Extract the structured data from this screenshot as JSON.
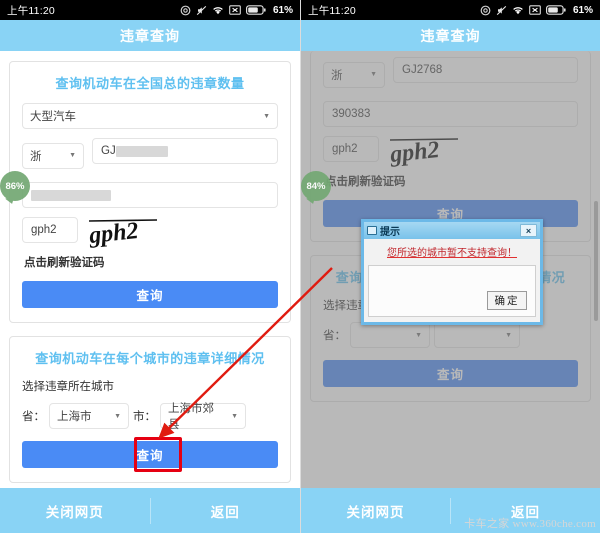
{
  "status_bar": {
    "time": "上午11:20",
    "battery_percent": "61%",
    "icons": [
      "ring-icon",
      "mute-icon",
      "wifi-icon",
      "no-sim-icon",
      "battery-icon"
    ]
  },
  "title_bar": {
    "title": "违章查询"
  },
  "bottom_bar": {
    "close_label": "关闭网页",
    "back_label": "返回"
  },
  "left_panel": {
    "badge": "86%",
    "card1": {
      "title": "查询机动车在全国总的违章数量",
      "vehicle_type": "大型汽车",
      "province": "浙",
      "plate_prefix": "GJ",
      "plate_rest": "",
      "vin": "",
      "captcha_value": "gph2",
      "captcha_image_text": "gph2",
      "refresh_label": "点击刷新验证码",
      "query_label": "查询"
    },
    "card2": {
      "title": "查询机动车在每个城市的违章详细情况",
      "sub_label": "选择违章所在城市",
      "province_label": "省：",
      "province_value": "上海市",
      "city_label": "市：",
      "city_value": "上海市郊县",
      "query_label": "查询"
    }
  },
  "right_panel": {
    "badge": "84%",
    "card1": {
      "province": "浙",
      "plate": "GJ2768",
      "vin": "390383",
      "captcha_value": "gph2",
      "captcha_image_text": "gph2",
      "refresh_label": "点击刷新验证码",
      "query_label": "查询"
    },
    "card2": {
      "title": "查询机动车在每个城市的违章详细情况",
      "sub_label": "选择违章所在城市",
      "province_label": "省：",
      "query_label": "查询"
    },
    "dialog": {
      "title": "提示",
      "close_label": "×",
      "message": "您所选的城市暂不支持查询！",
      "ok_label": "确定"
    }
  },
  "watermark": "卡车之家 www.360che.com",
  "colors": {
    "title_bar": "#89d3f5",
    "card_title": "#5fc0f0",
    "primary_button": "#4a8bf5",
    "highlight_box": "#e60012",
    "arrow": "#e01b10",
    "badge": "#73a873",
    "dialog_border": "#6cb9e8",
    "dialog_message": "#c1272d"
  }
}
